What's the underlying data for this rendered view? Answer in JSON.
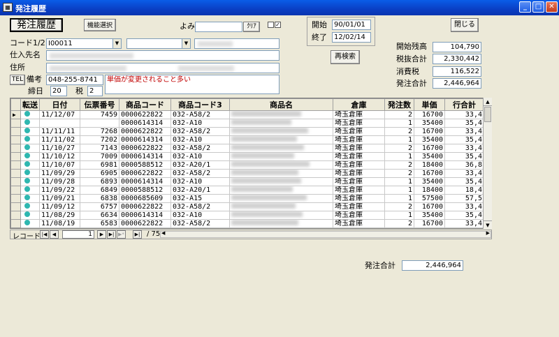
{
  "window": {
    "title": "発注履歴",
    "app_icon": "db-app-icon",
    "controls": [
      "_",
      "□",
      "✕"
    ]
  },
  "form": {
    "title_button": "発注履歴",
    "function_select_button": "機能選択",
    "yomi_label": "よみ",
    "yomi_value": "",
    "clear_button": "ｸﾘｱ",
    "check1": "",
    "check2": "✓",
    "start_label": "開始",
    "start_date": "90/01/01",
    "end_label": "終了",
    "end_date": "12/02/14",
    "research_button": "再検索",
    "close_button": "閉じる",
    "code_label": "コード1/2",
    "code1_value": "I00011",
    "supplier_label": "仕入先名",
    "address_label": "住所",
    "tel_button": "TEL",
    "tel_value": "048-255-8741",
    "note_label": "備考",
    "note_value": "単価が変更されること多い",
    "closing_label": "締日",
    "closing_value": "20",
    "tax_label": "税",
    "tax_value": "2",
    "summary": {
      "opening_balance_label": "開始残高",
      "opening_balance": "104,790",
      "tax_excluded_label": "税抜合計",
      "tax_excluded": "2,330,442",
      "consumption_tax_label": "消費税",
      "consumption_tax": "116,522",
      "order_total_label": "発注合計",
      "order_total": "2,446,964"
    }
  },
  "table": {
    "columns": [
      "転送",
      "日付",
      "伝票番号",
      "商品コード",
      "商品コード3",
      "商品名",
      "倉庫",
      "発注数",
      "単価",
      "行合計"
    ],
    "rows": [
      {
        "date": "11/12/07",
        "slip": "7459",
        "code": "0000622822",
        "code3": "032-A58/2",
        "warehouse": "埼玉倉庫",
        "qty": "2",
        "price": "16700",
        "total": "33,4"
      },
      {
        "date": "",
        "slip": "",
        "code": "0000614314",
        "code3": "032-A10",
        "warehouse": "埼玉倉庫",
        "qty": "1",
        "price": "35400",
        "total": "35,4"
      },
      {
        "date": "11/11/11",
        "slip": "7268",
        "code": "0000622822",
        "code3": "032-A58/2",
        "warehouse": "埼玉倉庫",
        "qty": "2",
        "price": "16700",
        "total": "33,4"
      },
      {
        "date": "11/11/02",
        "slip": "7202",
        "code": "0000614314",
        "code3": "032-A10",
        "warehouse": "埼玉倉庫",
        "qty": "1",
        "price": "35400",
        "total": "35,4"
      },
      {
        "date": "11/10/27",
        "slip": "7143",
        "code": "0000622822",
        "code3": "032-A58/2",
        "warehouse": "埼玉倉庫",
        "qty": "2",
        "price": "16700",
        "total": "33,4"
      },
      {
        "date": "11/10/12",
        "slip": "7009",
        "code": "0000614314",
        "code3": "032-A10",
        "warehouse": "埼玉倉庫",
        "qty": "1",
        "price": "35400",
        "total": "35,4"
      },
      {
        "date": "11/10/07",
        "slip": "6981",
        "code": "0000588512",
        "code3": "032-A20/1",
        "warehouse": "埼玉倉庫",
        "qty": "2",
        "price": "18400",
        "total": "36,8"
      },
      {
        "date": "11/09/29",
        "slip": "6905",
        "code": "0000622822",
        "code3": "032-A58/2",
        "warehouse": "埼玉倉庫",
        "qty": "2",
        "price": "16700",
        "total": "33,4"
      },
      {
        "date": "11/09/28",
        "slip": "6893",
        "code": "0000614314",
        "code3": "032-A10",
        "warehouse": "埼玉倉庫",
        "qty": "1",
        "price": "35400",
        "total": "35,4"
      },
      {
        "date": "11/09/22",
        "slip": "6849",
        "code": "0000588512",
        "code3": "032-A20/1",
        "warehouse": "埼玉倉庫",
        "qty": "1",
        "price": "18400",
        "total": "18,4"
      },
      {
        "date": "11/09/21",
        "slip": "6838",
        "code": "0000685609",
        "code3": "032-A15",
        "warehouse": "埼玉倉庫",
        "qty": "1",
        "price": "57500",
        "total": "57,5"
      },
      {
        "date": "11/09/12",
        "slip": "6757",
        "code": "0000622822",
        "code3": "032-A58/2",
        "warehouse": "埼玉倉庫",
        "qty": "2",
        "price": "16700",
        "total": "33,4"
      },
      {
        "date": "11/08/29",
        "slip": "6634",
        "code": "0000614314",
        "code3": "032-A10",
        "warehouse": "埼玉倉庫",
        "qty": "1",
        "price": "35400",
        "total": "35,4"
      },
      {
        "date": "11/08/19",
        "slip": "6583",
        "code": "0000622822",
        "code3": "032-A58/2",
        "warehouse": "埼玉倉庫",
        "qty": "2",
        "price": "16700",
        "total": "33,4"
      }
    ]
  },
  "navigator": {
    "record_label": "レコード:",
    "current": "1",
    "total_text": "/ 75"
  },
  "footer": {
    "order_total_label": "発注合計",
    "order_total": "2,446,964"
  },
  "colors": {
    "titlebar": "#0a3fc4",
    "transfer_dot": "#2fb7b0",
    "note_text": "#c00000"
  }
}
